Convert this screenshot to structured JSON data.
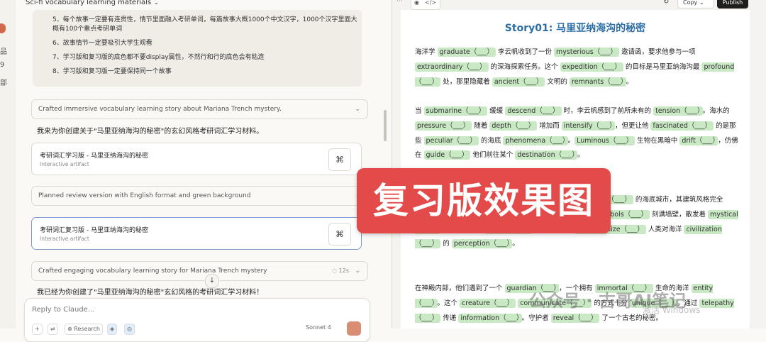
{
  "chat": {
    "title": "Sci-fi vocabulary learning materials",
    "rules": [
      "5、每个故事一定要有连贯性，情节里面融入考研单词，每篇故事大概1000个中文汉字，1000个汉字里面大概有100个重点考研单词",
      "6、故事情节一定要吸引大学生观看",
      "7、学习版和复习版的底色都不要display属性，不然行和行的底色会有粘连",
      "8、学习版和复习版一定要保持同一个故事"
    ],
    "summary1": "Crafted immersive vocabulary learning story about Mariana Trench mystery.",
    "para1": "我来为你创建关于\"马里亚纳海沟的秘密\"的玄幻风格考研词汇学习材料。",
    "artifact1": {
      "title": "考研词汇学习版 - 马里亚纳海沟的秘密",
      "subtitle": "Interactive artifact"
    },
    "summary2": "Planned review version with English format and green background",
    "artifact2": {
      "title": "考研词汇复习版 - 马里亚纳海沟的秘密",
      "subtitle": "Interactive artifact"
    },
    "summary3": "Crafted engaging vocabulary learning story for Mariana Trench mystery",
    "summary3_time": "12s",
    "para2": "我已经为你创建了\"马里亚纳海沟的秘密\"玄幻风格的考研词汇学习材料！",
    "composer_placeholder": "Reply to Claude...",
    "research_label": "Research",
    "model_label": "Sonnet 4"
  },
  "pane": {
    "copy_label": "Copy",
    "publish_label": "Publish",
    "story_title": "Story01: 马里亚纳海沟的秘密"
  },
  "overlay": {
    "banner": "复习版效果图",
    "watermark": "公众号 · 古哥AI笔记",
    "windows": "激活 Windows"
  },
  "colors": {
    "highlight": "#c9e8c4",
    "title_blue": "#2c6ea6",
    "banner": "#e34b4b",
    "publish": "#1f1e1d"
  }
}
